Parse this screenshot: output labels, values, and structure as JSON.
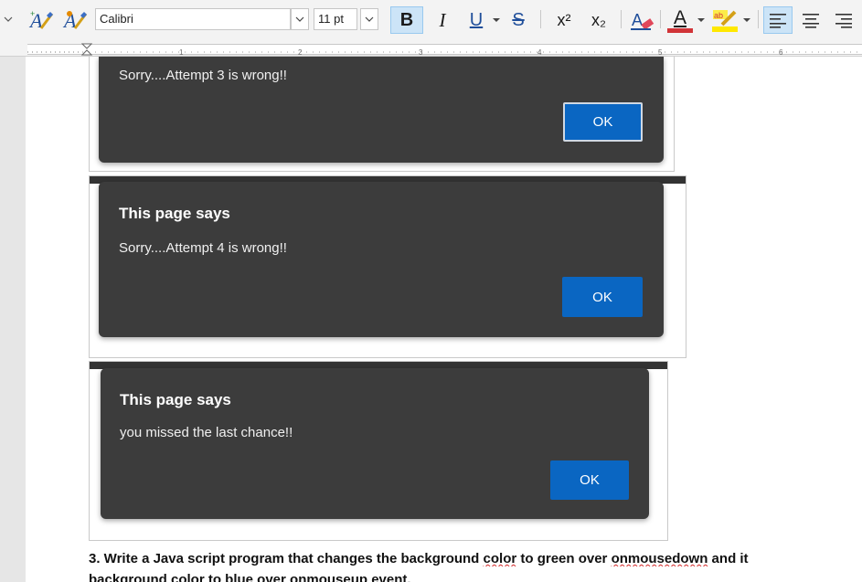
{
  "toolbar": {
    "font_name": "Calibri",
    "font_size": "11 pt",
    "bold": "B",
    "italic": "I",
    "underline": "U",
    "strike": "S",
    "superscript": "x²",
    "subscript": "x₂",
    "font_color_letter": "A",
    "font_color": "#d13438",
    "highlight_color": "#ffe800",
    "accent": "#cce4f7"
  },
  "dialogs": [
    {
      "title": "",
      "message": "Sorry....Attempt 3 is wrong!!",
      "ok_label": "OK",
      "focused": true
    },
    {
      "title": "This page says",
      "message": "Sorry....Attempt 4 is wrong!!",
      "ok_label": "OK",
      "focused": false
    },
    {
      "title": "This page says",
      "message": "you missed the last chance!!",
      "ok_label": "OK",
      "focused": false
    }
  ],
  "document": {
    "question_line1_a": "3. Write a Java script program that changes the background ",
    "question_line1_b": "color",
    "question_line1_c": " to green over ",
    "question_line1_d": "onmousedown",
    "question_line1_e": " and it",
    "question_line2": "background color to blue over onmouseup event."
  }
}
